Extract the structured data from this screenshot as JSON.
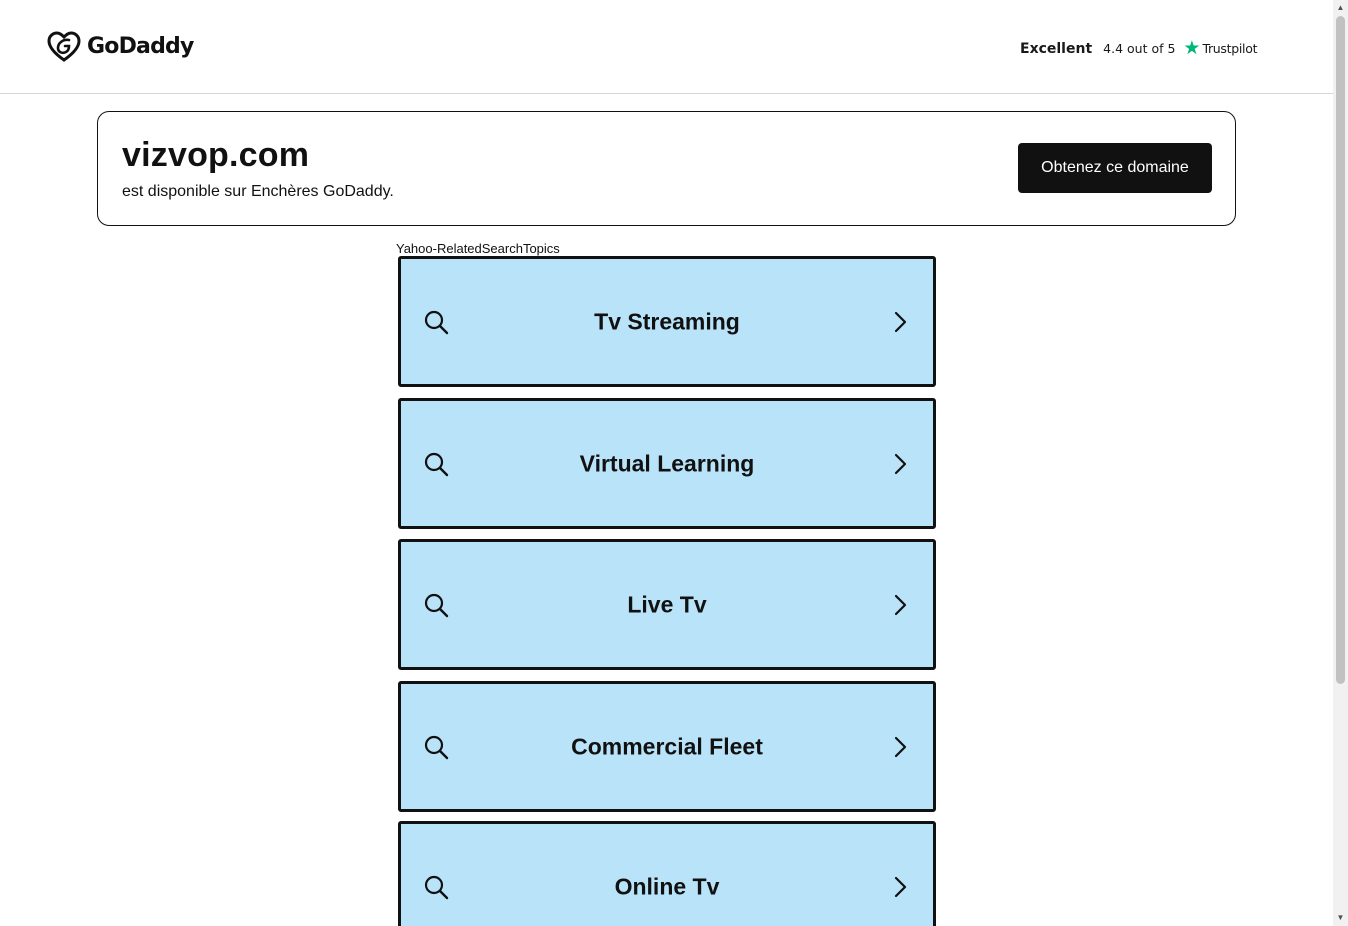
{
  "header": {
    "brand": "GoDaddy",
    "trustpilot": {
      "rating_word": "Excellent",
      "score_text": "4.4 out of 5",
      "brand": "Trustpilot",
      "star_color": "#00b67a"
    }
  },
  "banner": {
    "domain": "vizvop.com",
    "subtitle": "est disponible sur Enchères GoDaddy.",
    "cta_label": "Obtenez ce domaine"
  },
  "related": {
    "title": "Yahoo-RelatedSearchTopics",
    "tile_color": "#b9e3f9",
    "topics": [
      {
        "label": "Tv Streaming"
      },
      {
        "label": "Virtual Learning"
      },
      {
        "label": "Live Tv"
      },
      {
        "label": "Commercial Fleet"
      },
      {
        "label": "Online Tv"
      }
    ]
  }
}
